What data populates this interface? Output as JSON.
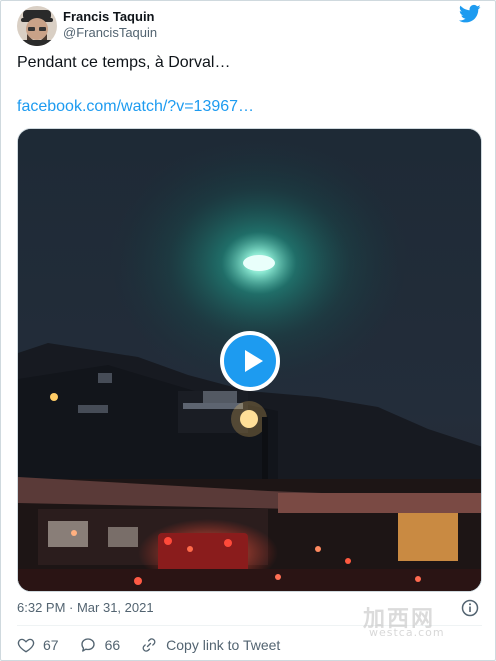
{
  "author": {
    "display_name": "Francis Taquin",
    "handle": "@FrancisTaquin"
  },
  "tweet": {
    "text": "Pendant ce temps, à Dorval…",
    "link": "facebook.com/watch/?v=13967…"
  },
  "media": {
    "type": "video",
    "play_icon": "play-icon"
  },
  "meta": {
    "timestamp": "6:32 PM · Mar 31, 2021"
  },
  "actions": {
    "likes": "67",
    "replies": "66",
    "copy_link_label": "Copy link to Tweet"
  },
  "icons": {
    "brand": "twitter-bird-icon",
    "info": "info-icon",
    "like": "heart-icon",
    "reply": "reply-bubble-icon",
    "link": "link-icon"
  },
  "colors": {
    "accent": "#1d9bf0",
    "text": "#0f1419",
    "secondary": "#536471"
  },
  "watermark": {
    "main": "加西网",
    "sub": "westca.com"
  }
}
